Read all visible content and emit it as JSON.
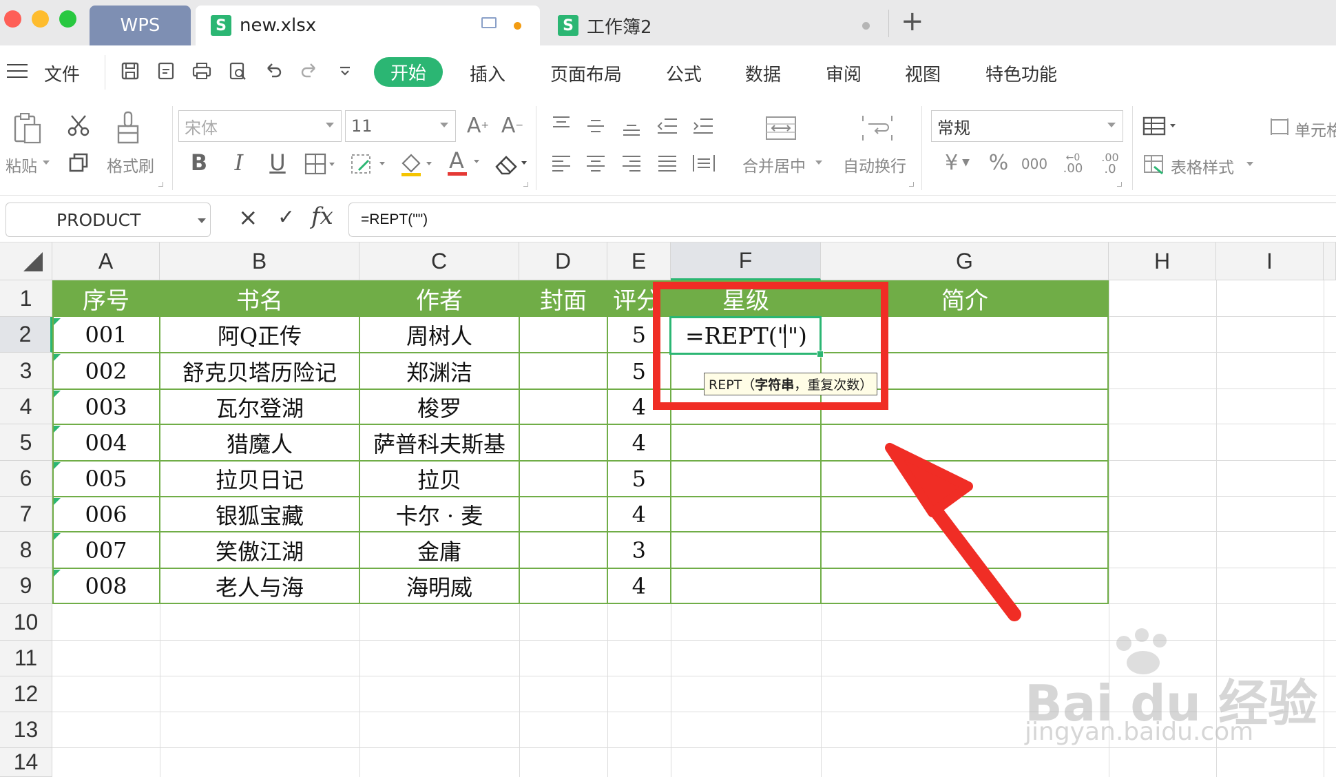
{
  "tabs": {
    "home": "WPS",
    "file1": "new.xlsx",
    "file2": "工作簿2",
    "new_tab_symbol": "+"
  },
  "menu": {
    "file": "文件",
    "items": [
      "开始",
      "插入",
      "页面布局",
      "公式",
      "数据",
      "审阅",
      "视图",
      "特色功能"
    ],
    "active": "开始"
  },
  "ribbon": {
    "paste": "粘贴",
    "format_painter": "格式刷",
    "font_name": "宋体",
    "font_size": "11",
    "merge_center": "合并居中",
    "wrap_text": "自动换行",
    "number_format": "常规",
    "percent": "%",
    "thousands": "000",
    "dec_inc": ".00",
    "dec_dec": ".0",
    "table_style": "表格样式",
    "cell": "单元格",
    "bold": "B",
    "italic": "I",
    "underline": "U",
    "font_color": "A",
    "currency": "¥"
  },
  "formula_bar": {
    "name_box": "PRODUCT",
    "cancel": "×",
    "confirm": "✓",
    "fx": "fx",
    "formula": "=REPT(\"\")"
  },
  "grid": {
    "columns": [
      "A",
      "B",
      "C",
      "D",
      "E",
      "F",
      "G",
      "H",
      "I"
    ],
    "rows": [
      "1",
      "2",
      "3",
      "4",
      "5",
      "6",
      "7",
      "8",
      "9",
      "10",
      "11",
      "12",
      "13",
      "14"
    ],
    "header_row": [
      "序号",
      "书名",
      "作者",
      "封面",
      "评分",
      "星级",
      "简介"
    ],
    "data": [
      [
        "001",
        "阿Q正传",
        "周树人",
        "",
        "5"
      ],
      [
        "002",
        "舒克贝塔历险记",
        "郑渊洁",
        "",
        "5"
      ],
      [
        "003",
        "瓦尔登湖",
        "梭罗",
        "",
        "4"
      ],
      [
        "004",
        "猎魔人",
        "萨普科夫斯基",
        "",
        "4"
      ],
      [
        "005",
        "拉贝日记",
        "拉贝",
        "",
        "5"
      ],
      [
        "006",
        "银狐宝藏",
        "卡尔 · 麦",
        "",
        "4"
      ],
      [
        "007",
        "笑傲江湖",
        "金庸",
        "",
        "3"
      ],
      [
        "008",
        "老人与海",
        "海明威",
        "",
        "4"
      ]
    ],
    "active_cell_text": "=REPT(\"\")",
    "tooltip": {
      "prefix": "REPT（",
      "arg1": "字符串",
      "rest": "，重复次数）"
    },
    "header_fill": "#70ad47",
    "accent": "#2bb673",
    "highlight": "#f02d25"
  },
  "watermark": {
    "brand": "Bai du 经验",
    "url": "jingyan.baidu.com"
  }
}
